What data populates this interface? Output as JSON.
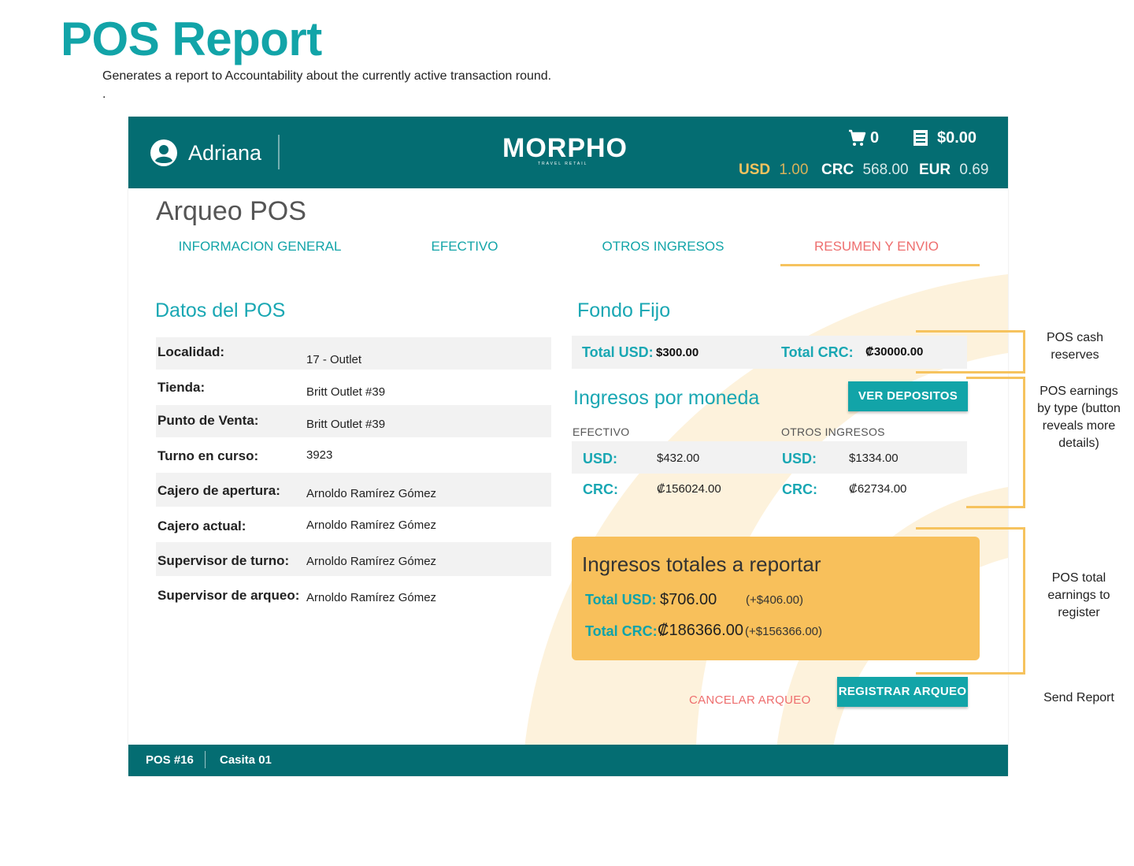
{
  "doc": {
    "title": "POS Report",
    "subtitle": "Generates a report to Accountability about the currently active transaction round.",
    "dot": "."
  },
  "header": {
    "user_name": "Adriana",
    "logo": "MORPHO",
    "logo_sub": "TRAVEL RETAIL",
    "cart_count": "0",
    "total": "$0.00",
    "currencies": [
      {
        "code": "USD",
        "rate": "1.00"
      },
      {
        "code": "CRC",
        "rate": "568.00"
      },
      {
        "code": "EUR",
        "rate": "0.69"
      }
    ]
  },
  "page": {
    "title": "Arqueo POS",
    "tabs": [
      {
        "label": "INFORMACION GENERAL"
      },
      {
        "label": "EFECTIVO"
      },
      {
        "label": "OTROS INGRESOS"
      },
      {
        "label": "RESUMEN Y ENVIO"
      }
    ]
  },
  "datos": {
    "heading": "Datos del POS",
    "rows": [
      {
        "label": "Localidad:",
        "value": "17 - Outlet"
      },
      {
        "label": "Tienda:",
        "value": "Britt Outlet #39"
      },
      {
        "label": "Punto de Venta:",
        "value": "Britt Outlet #39"
      },
      {
        "label": "Turno en curso:",
        "value": "3923"
      },
      {
        "label": "Cajero de apertura:",
        "value": "Arnoldo Ramírez Gómez"
      },
      {
        "label": "Cajero actual:",
        "value": "Arnoldo Ramírez Gómez"
      },
      {
        "label": "Supervisor de turno:",
        "value": "Arnoldo Ramírez Gómez"
      },
      {
        "label": "Supervisor de arqueo:",
        "value": "Arnoldo Ramírez Gómez"
      }
    ]
  },
  "fondo": {
    "heading": "Fondo Fijo",
    "usd_label": "Total USD:",
    "usd_value": "$300.00",
    "crc_label": "Total CRC:",
    "crc_value": "₡30000.00"
  },
  "ingresos": {
    "heading": "Ingresos por moneda",
    "button": "VER DEPOSITOS",
    "efectivo": {
      "title": "EFECTIVO",
      "usd_label": "USD:",
      "usd_value": "$432.00",
      "crc_label": "CRC:",
      "crc_value": "₡156024.00"
    },
    "otros": {
      "title": "OTROS INGRESOS",
      "usd_label": "USD:",
      "usd_value": "$1334.00",
      "crc_label": "CRC:",
      "crc_value": "₡62734.00"
    }
  },
  "totales": {
    "title": "Ingresos totales a reportar",
    "usd_label": "Total USD:",
    "usd_value": "$706.00",
    "usd_diff": "(+$406.00)",
    "crc_label": "Total CRC:",
    "crc_value": "₡186366.00",
    "crc_diff": "(+$156366.00)"
  },
  "actions": {
    "cancel": "CANCELAR ARQUEO",
    "submit": "REGISTRAR ARQUEO"
  },
  "footer": {
    "pos": "POS #16",
    "store": "Casita 01"
  },
  "annotations": {
    "cash": "POS cash reserves",
    "earnings": "POS earnings by type (button reveals more details)",
    "total": "POS total earnings to register",
    "send": "Send Report"
  },
  "colors": {
    "brand_teal": "#046d72",
    "accent_teal": "#12a4a8",
    "highlight_yellow": "#f8c05b",
    "cancel_red": "#ee6e6e"
  }
}
